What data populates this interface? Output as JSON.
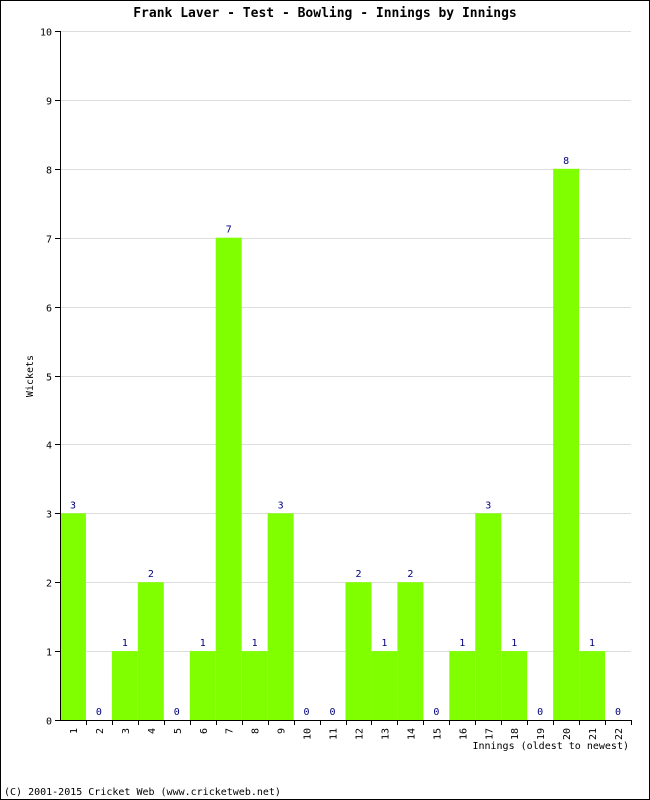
{
  "chart_data": {
    "type": "bar",
    "title": "Frank Laver - Test - Bowling - Innings by Innings",
    "xlabel": "Innings (oldest to newest)",
    "ylabel": "Wickets",
    "ylim": [
      0,
      10
    ],
    "yticks": [
      0,
      1,
      2,
      3,
      4,
      5,
      6,
      7,
      8,
      9,
      10
    ],
    "grid": true,
    "categories": [
      "1",
      "2",
      "3",
      "4",
      "5",
      "6",
      "7",
      "8",
      "9",
      "10",
      "11",
      "12",
      "13",
      "14",
      "15",
      "16",
      "17",
      "18",
      "19",
      "20",
      "21",
      "22"
    ],
    "values": [
      3,
      0,
      1,
      2,
      0,
      1,
      7,
      1,
      3,
      0,
      0,
      2,
      1,
      2,
      0,
      1,
      3,
      1,
      0,
      8,
      1,
      0
    ],
    "bar_color": "#80ff00",
    "value_label_color": "#000080",
    "grid_color": "#dddddd"
  },
  "footer": "(C) 2001-2015 Cricket Web (www.cricketweb.net)"
}
